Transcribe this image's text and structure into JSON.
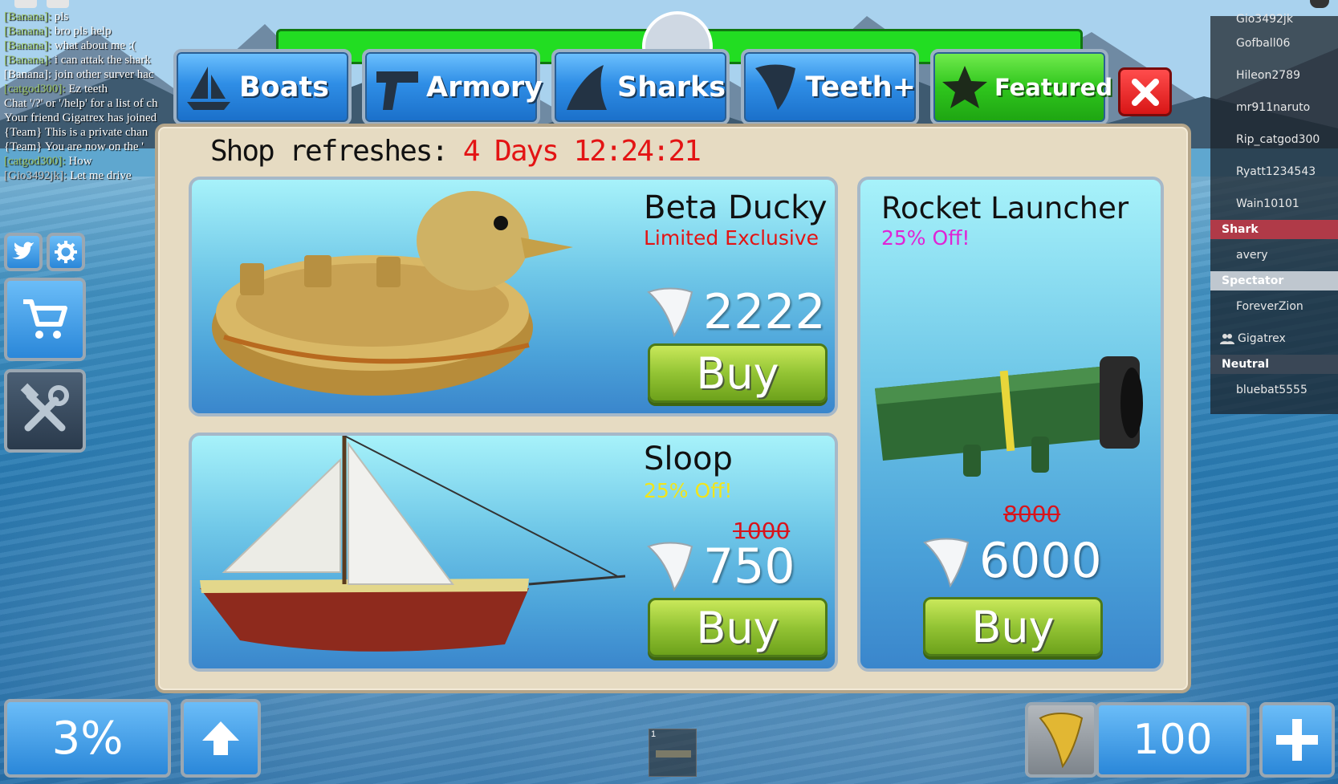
{
  "chat": [
    {
      "name": "[Banana]:",
      "text": " pls",
      "color": "green"
    },
    {
      "name": "[Banana]:",
      "text": " bro pls help",
      "color": "green"
    },
    {
      "name": "[Banana]:",
      "text": " what about me :(",
      "color": "green"
    },
    {
      "name": "[Banana]:",
      "text": " i can attak the shark",
      "color": "green"
    },
    {
      "name": "",
      "text": "[Banana]: join other surver hac",
      "color": "white"
    },
    {
      "name": "[catgod300]:",
      "text": "  Ez teeth",
      "color": "green"
    },
    {
      "name": "",
      "text": "Chat '/?' or '/help' for a list of ch",
      "color": "white"
    },
    {
      "name": "",
      "text": "Your friend Gigatrex has joined",
      "color": "white"
    },
    {
      "name": "",
      "text": "{Team} This is a private chan",
      "color": "white"
    },
    {
      "name": "",
      "text": "{Team} You are now on the '",
      "color": "white"
    },
    {
      "name": "[catgod300]:",
      "text": "  How",
      "color": "green"
    },
    {
      "name": "[Gio3492jk]:",
      "text": "  Let me drive",
      "color": "gray"
    }
  ],
  "tabs": [
    {
      "label": "Boats",
      "icon": "sailboat-icon"
    },
    {
      "label": "Armory",
      "icon": "gun-icon"
    },
    {
      "label": "Sharks",
      "icon": "shark-fin-icon"
    },
    {
      "label": "Teeth+",
      "icon": "tooth-icon"
    },
    {
      "label": "Featured",
      "icon": "star-icon"
    }
  ],
  "shop": {
    "refresh_label": "Shop refreshes:",
    "refresh_time": "4 Days 12:24:21",
    "items": {
      "beta_ducky": {
        "name": "Beta Ducky",
        "subtitle": "Limited Exclusive",
        "price": "2222",
        "buy": "Buy"
      },
      "sloop": {
        "name": "Sloop",
        "subtitle": "25% Off!",
        "old_price": "1000",
        "price": "750",
        "buy": "Buy"
      },
      "rocket": {
        "name": "Rocket Launcher",
        "subtitle": "25% Off!",
        "old_price": "8000",
        "price": "6000",
        "buy": "Buy"
      }
    }
  },
  "players": {
    "top_cut": "Gio3492jk",
    "list_a": [
      "Gofball06",
      "Hileon2789",
      "mr911naruto",
      "Rip_catgod300",
      "Ryatt1234543",
      "Wain10101"
    ],
    "team_shark": "Shark",
    "shark_players": [
      "avery"
    ],
    "team_spectator": "Spectator",
    "spectator_players": [
      "ForeverZion"
    ],
    "friend": "Gigatrex",
    "team_neutral": "Neutral",
    "neutral_players": [
      "bluebat5555"
    ]
  },
  "hud": {
    "percent": "3%",
    "teeth": "100",
    "hotbar_slot": "1"
  },
  "colors": {
    "refresh_time": "#e31414",
    "limited": "#e31414",
    "sloop_discount": "#f2e51a",
    "rocket_discount": "#e023d6",
    "shark_team": "#b03a48",
    "spectator_team": "#bfc7cf"
  }
}
